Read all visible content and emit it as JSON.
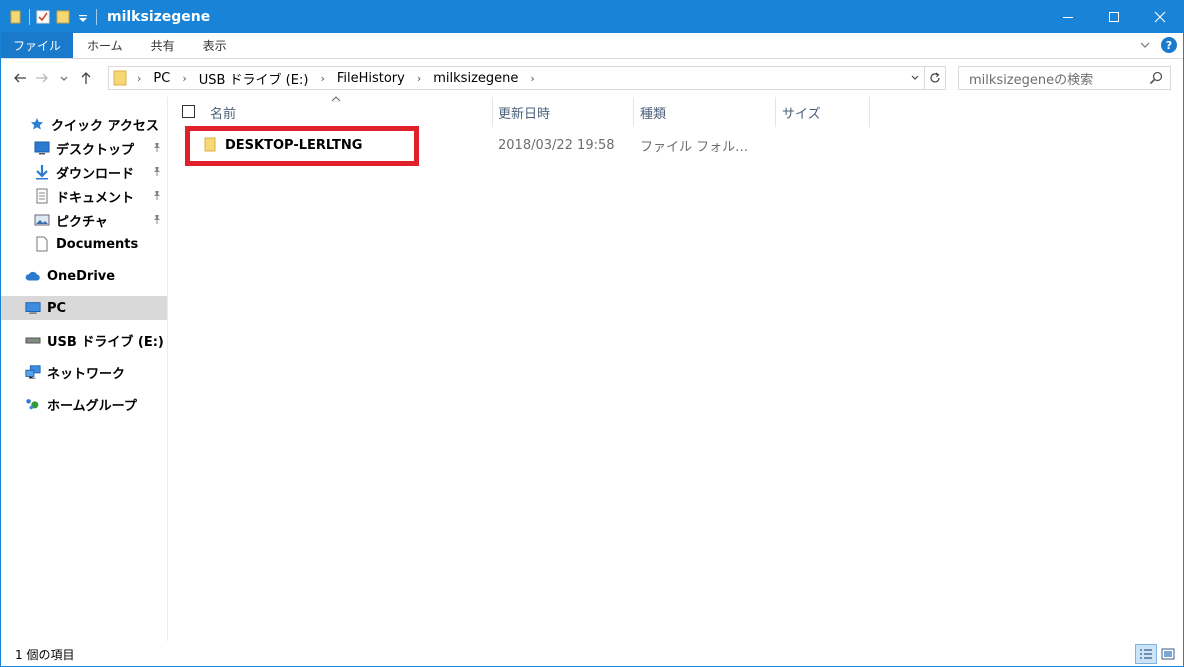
{
  "window": {
    "title": "milksizegene",
    "controls": {
      "minimize": "—",
      "maximize": "☐",
      "close": "✕"
    }
  },
  "ribbon": {
    "tabs": [
      {
        "label": "ファイル",
        "active": true
      },
      {
        "label": "ホーム"
      },
      {
        "label": "共有"
      },
      {
        "label": "表示"
      }
    ],
    "help": "?"
  },
  "address": {
    "breadcrumbs": [
      "PC",
      "USB ドライブ (E:)",
      "FileHistory",
      "milksizegene"
    ]
  },
  "search": {
    "placeholder": "milksizegeneの検索"
  },
  "sidebar": {
    "items": [
      {
        "label": "クイック アクセス",
        "icon": "star-icon"
      },
      {
        "label": "デスクトップ",
        "icon": "desktop-icon",
        "pinned": true
      },
      {
        "label": "ダウンロード",
        "icon": "download-icon",
        "pinned": true
      },
      {
        "label": "ドキュメント",
        "icon": "document-icon",
        "pinned": true
      },
      {
        "label": "ピクチャ",
        "icon": "picture-icon",
        "pinned": true
      },
      {
        "label": "Documents",
        "icon": "file-icon"
      },
      {
        "label": "OneDrive",
        "icon": "cloud-icon"
      },
      {
        "label": "PC",
        "icon": "computer-icon",
        "selected": true
      },
      {
        "label": "USB ドライブ (E:)",
        "icon": "usb-drive-icon"
      },
      {
        "label": "ネットワーク",
        "icon": "network-icon"
      },
      {
        "label": "ホームグループ",
        "icon": "homegroup-icon"
      }
    ]
  },
  "columns": {
    "name": "名前",
    "date": "更新日時",
    "type": "種類",
    "size": "サイズ"
  },
  "files": [
    {
      "name": "DESKTOP-LERLTNG",
      "date": "2018/03/22 19:58",
      "type": "ファイル フォル…",
      "size": ""
    }
  ],
  "status": {
    "item_count": "1 個の項目"
  },
  "colors": {
    "accent": "#1883d7",
    "highlight": "#e0202a",
    "folder": "#f8d775"
  }
}
